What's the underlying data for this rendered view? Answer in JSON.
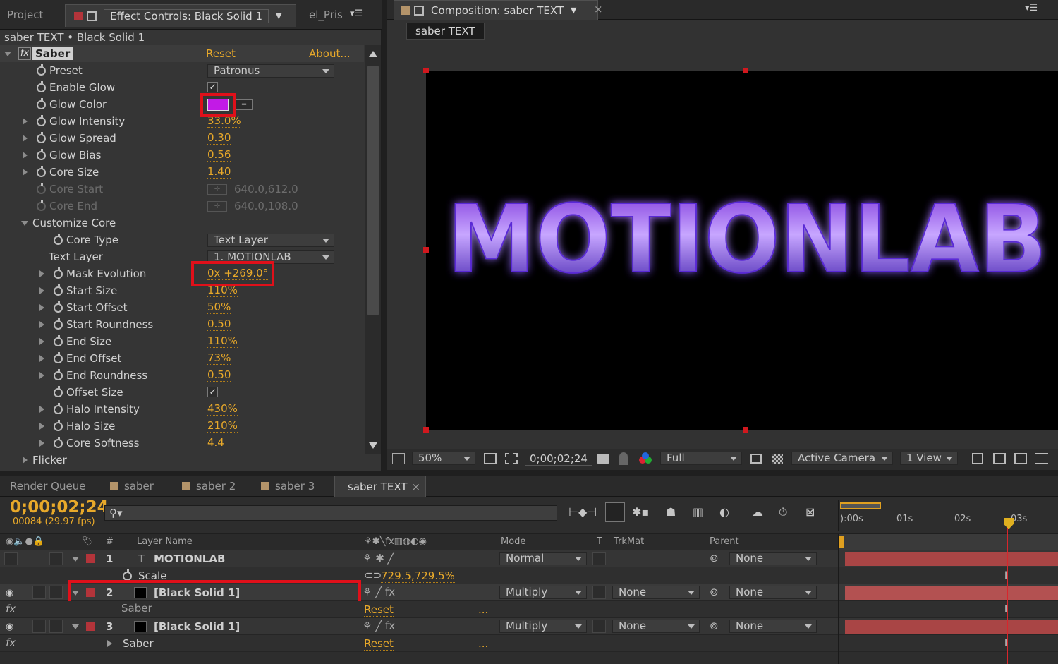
{
  "left_tabs": {
    "project": "Project",
    "effect_controls": "Effect Controls: Black Solid 1",
    "pris": "el_Pris"
  },
  "breadcrumb": "saber TEXT • Black Solid 1",
  "effect": {
    "fx": "fx",
    "name": "Saber",
    "reset": "Reset",
    "about": "About..."
  },
  "properties": {
    "preset": {
      "label": "Preset",
      "value": "Patronus"
    },
    "enable_glow": {
      "label": "Enable Glow",
      "checked": "✓"
    },
    "glow_color": {
      "label": "Glow Color",
      "color": "#c21ae6"
    },
    "glow_intensity": {
      "label": "Glow Intensity",
      "value": "33.0%"
    },
    "glow_spread": {
      "label": "Glow Spread",
      "value": "0.30"
    },
    "glow_bias": {
      "label": "Glow Bias",
      "value": "0.56"
    },
    "core_size": {
      "label": "Core Size",
      "value": "1.40"
    },
    "core_start": {
      "label": "Core Start",
      "value": "640.0,612.0"
    },
    "core_end": {
      "label": "Core End",
      "value": "640.0,108.0"
    },
    "customize_core": {
      "label": "Customize Core"
    },
    "core_type": {
      "label": "Core Type",
      "value": "Text Layer"
    },
    "text_layer": {
      "label": "Text Layer",
      "value": "1. MOTIONLAB"
    },
    "mask_evolution": {
      "label": "Mask Evolution",
      "value": "0x +269.0°"
    },
    "start_size": {
      "label": "Start Size",
      "value": "110%"
    },
    "start_offset": {
      "label": "Start Offset",
      "value": "50%"
    },
    "start_roundness": {
      "label": "Start Roundness",
      "value": "0.50"
    },
    "end_size": {
      "label": "End Size",
      "value": "110%"
    },
    "end_offset": {
      "label": "End Offset",
      "value": "73%"
    },
    "end_roundness": {
      "label": "End Roundness",
      "value": "0.50"
    },
    "offset_size": {
      "label": "Offset Size",
      "checked": "✓"
    },
    "halo_intensity": {
      "label": "Halo Intensity",
      "value": "430%"
    },
    "halo_size": {
      "label": "Halo Size",
      "value": "210%"
    },
    "core_softness": {
      "label": "Core Softness",
      "value": "4.4"
    },
    "flicker": {
      "label": "Flicker"
    }
  },
  "composition": {
    "tab": "Composition: saber TEXT",
    "subtab": "saber TEXT",
    "text": "MOTIONLAB",
    "zoom": "50%",
    "timecode": "0;00;02;24",
    "resolution": "Full",
    "camera": "Active Camera",
    "view": "1 View"
  },
  "bottom_tabs": {
    "render_queue": "Render Queue",
    "saber": "saber",
    "saber2": "saber 2",
    "saber3": "saber 3",
    "saber_text": "saber TEXT"
  },
  "timeline": {
    "timecode": "0;00;02;24",
    "frames": "00084 (29.97 fps)",
    "headers": {
      "num": "#",
      "layer_name": "Layer Name",
      "mode": "Mode",
      "t": "T",
      "trkmat": "TrkMat",
      "parent": "Parent"
    },
    "ruler": {
      "t0": "):00s",
      "t1": "01s",
      "t2": "02s",
      "t3": "03s"
    },
    "layers": [
      {
        "num": "1",
        "name": "MOTIONLAB",
        "mode": "Normal",
        "parent": "None"
      },
      {
        "sub": "Scale",
        "value": "729.5,729.5%"
      },
      {
        "num": "2",
        "name": "[Black Solid 1]",
        "mode": "Multiply",
        "trkmat": "None",
        "parent": "None"
      },
      {
        "sub": "Saber",
        "reset": "Reset",
        "more": "..."
      },
      {
        "num": "3",
        "name": "[Black Solid 1]",
        "mode": "Multiply",
        "trkmat": "None",
        "parent": "None"
      },
      {
        "sub": "Saber",
        "reset": "Reset",
        "more": "..."
      }
    ]
  },
  "colors": {
    "accent": "#e8a92a",
    "highlight": "#e0101a",
    "label_red": "#b3343a"
  }
}
